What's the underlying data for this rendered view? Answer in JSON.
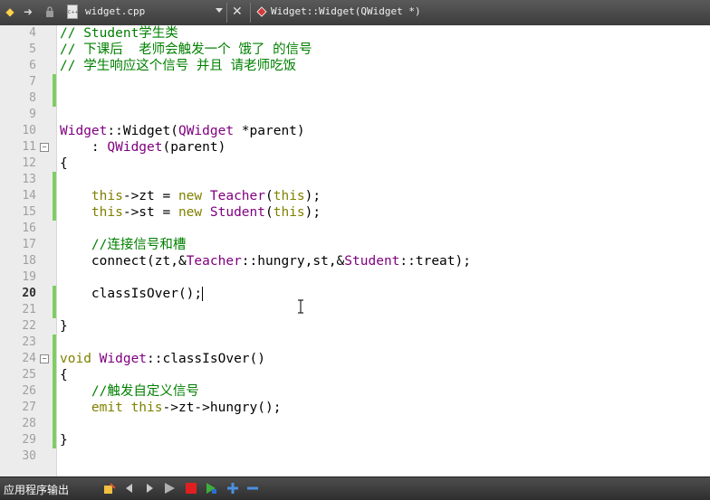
{
  "tabs": {
    "file_name": "widget.cpp",
    "file_icon_label": "C++",
    "function_name": "Widget::Widget(QWidget *)"
  },
  "editor": {
    "current_line": "20",
    "lines": [
      {
        "n": "4",
        "fold": "",
        "changed": false,
        "code": "// Student学生类"
      },
      {
        "n": "5",
        "fold": "",
        "changed": false,
        "code": "// 下课后  老师会触发一个 饿了 的信号"
      },
      {
        "n": "6",
        "fold": "",
        "changed": false,
        "code": "// 学生响应这个信号 并且 请老师吃饭"
      },
      {
        "n": "7",
        "fold": "",
        "changed": true,
        "code": ""
      },
      {
        "n": "8",
        "fold": "",
        "changed": true,
        "code": ""
      },
      {
        "n": "9",
        "fold": "",
        "changed": false,
        "code": ""
      },
      {
        "n": "10",
        "fold": "",
        "changed": false,
        "code": "Widget::Widget(QWidget *parent)"
      },
      {
        "n": "11",
        "fold": "⊟",
        "changed": false,
        "code": "    : QWidget(parent)"
      },
      {
        "n": "12",
        "fold": "",
        "changed": false,
        "code": "{"
      },
      {
        "n": "13",
        "fold": "",
        "changed": true,
        "code": ""
      },
      {
        "n": "14",
        "fold": "",
        "changed": true,
        "code": "    this->zt = new Teacher(this);"
      },
      {
        "n": "15",
        "fold": "",
        "changed": true,
        "code": "    this->st = new Student(this);"
      },
      {
        "n": "16",
        "fold": "",
        "changed": false,
        "code": ""
      },
      {
        "n": "17",
        "fold": "",
        "changed": false,
        "code": "    //连接信号和槽"
      },
      {
        "n": "18",
        "fold": "",
        "changed": false,
        "code": "    connect(zt,&Teacher::hungry,st,&Student::treat);"
      },
      {
        "n": "19",
        "fold": "",
        "changed": false,
        "code": ""
      },
      {
        "n": "20",
        "fold": "",
        "changed": true,
        "code": "    classIsOver();"
      },
      {
        "n": "21",
        "fold": "",
        "changed": true,
        "code": ""
      },
      {
        "n": "22",
        "fold": "",
        "changed": false,
        "code": "}"
      },
      {
        "n": "23",
        "fold": "",
        "changed": true,
        "code": ""
      },
      {
        "n": "24",
        "fold": "⊟",
        "changed": true,
        "code": "void Widget::classIsOver()"
      },
      {
        "n": "25",
        "fold": "",
        "changed": true,
        "code": "{"
      },
      {
        "n": "26",
        "fold": "",
        "changed": true,
        "code": "    //触发自定义信号"
      },
      {
        "n": "27",
        "fold": "",
        "changed": true,
        "code": "    emit this->zt->hungry();"
      },
      {
        "n": "28",
        "fold": "",
        "changed": true,
        "code": ""
      },
      {
        "n": "29",
        "fold": "",
        "changed": true,
        "code": "}"
      },
      {
        "n": "30",
        "fold": "",
        "changed": false,
        "code": ""
      }
    ]
  },
  "bottom_panel": {
    "title": "应用程序输出"
  },
  "colors": {
    "comment": "#008000",
    "keyword": "#808000",
    "type": "#800080",
    "change_marker": "#7fce62"
  }
}
